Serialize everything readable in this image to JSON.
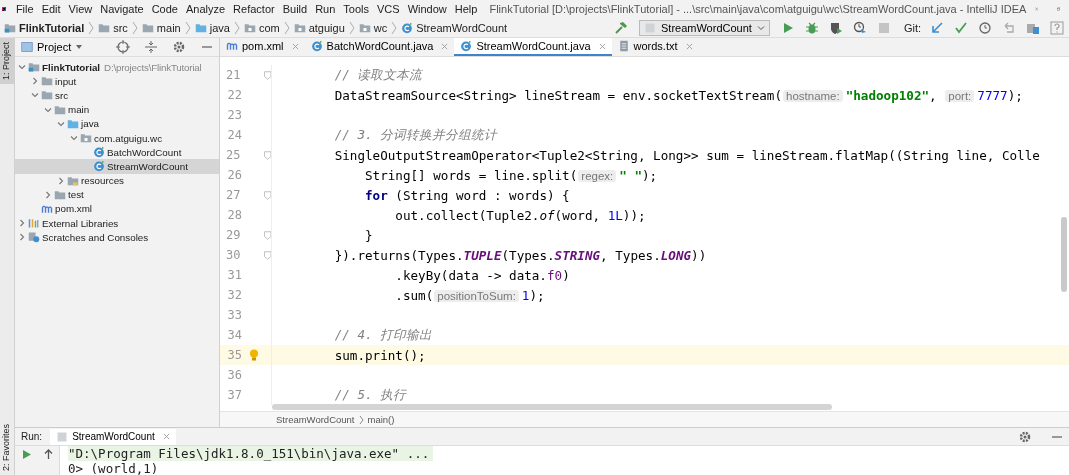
{
  "window": {
    "title": "FlinkTutorial [D:\\projects\\FlinkTutorial] - ...\\src\\main\\java\\com\\atguigu\\wc\\StreamWordCount.java - IntelliJ IDEA"
  },
  "menu": [
    "File",
    "Edit",
    "View",
    "Navigate",
    "Code",
    "Analyze",
    "Refactor",
    "Build",
    "Run",
    "Tools",
    "VCS",
    "Window",
    "Help"
  ],
  "nav_bar": {
    "crumbs": [
      {
        "label": "FlinkTutorial",
        "kind": "module"
      },
      {
        "label": "src",
        "kind": "folder"
      },
      {
        "label": "main",
        "kind": "folder"
      },
      {
        "label": "java",
        "kind": "source"
      },
      {
        "label": "com",
        "kind": "package"
      },
      {
        "label": "atguigu",
        "kind": "package"
      },
      {
        "label": "wc",
        "kind": "package"
      },
      {
        "label": "StreamWordCount",
        "kind": "class"
      }
    ],
    "run_config": "StreamWordCount",
    "vcs_label": "Git:"
  },
  "side_strip": {
    "top_tab": "1: Project",
    "bottom_tab": "2: Favorites"
  },
  "project": {
    "title": "Project",
    "tree": [
      {
        "label": "FlinkTutorial",
        "path": "D:\\projects\\FlinkTutorial",
        "kind": "module",
        "expanded": true,
        "selected": false,
        "children": [
          {
            "label": "input",
            "kind": "folder",
            "expanded": false,
            "selected": false
          },
          {
            "label": "src",
            "kind": "folder",
            "expanded": true,
            "selected": false,
            "children": [
              {
                "label": "main",
                "kind": "folder",
                "expanded": true,
                "selected": false,
                "children": [
                  {
                    "label": "java",
                    "kind": "source",
                    "expanded": true,
                    "selected": false,
                    "children": [
                      {
                        "label": "com.atguigu.wc",
                        "kind": "package",
                        "expanded": true,
                        "selected": false,
                        "children": [
                          {
                            "label": "BatchWordCount",
                            "kind": "class",
                            "selected": false
                          },
                          {
                            "label": "StreamWordCount",
                            "kind": "class",
                            "selected": true
                          }
                        ]
                      }
                    ]
                  },
                  {
                    "label": "resources",
                    "kind": "resources",
                    "expanded": false,
                    "selected": false
                  }
                ]
              },
              {
                "label": "test",
                "kind": "folder",
                "expanded": false,
                "selected": false
              }
            ]
          },
          {
            "label": "pom.xml",
            "kind": "maven",
            "selected": false
          }
        ]
      },
      {
        "label": "External Libraries",
        "kind": "libraries",
        "expanded": false,
        "selected": false
      },
      {
        "label": "Scratches and Consoles",
        "kind": "scratches",
        "expanded": false,
        "selected": false
      }
    ]
  },
  "tabs": [
    {
      "label": "pom.xml",
      "kind": "maven",
      "selected": false
    },
    {
      "label": "BatchWordCount.java",
      "kind": "class",
      "selected": false
    },
    {
      "label": "StreamWordCount.java",
      "kind": "class",
      "selected": true
    },
    {
      "label": "words.txt",
      "kind": "text",
      "selected": false
    }
  ],
  "editor": {
    "lines": [
      {
        "number": "21",
        "fold": true,
        "current": false,
        "tokens": [
          {
            "kind": "comment",
            "text": "        // 读取文本流"
          }
        ]
      },
      {
        "number": "22",
        "fold": false,
        "current": false,
        "tokens": [
          {
            "kind": "plain",
            "text": "        DataStreamSource<String> lineStream = env.socketTextStream("
          },
          {
            "kind": "hint",
            "text": "hostname:"
          },
          {
            "kind": "string",
            "text": "\"hadoop102\""
          },
          {
            "kind": "plain",
            "text": ", "
          },
          {
            "kind": "hint",
            "text": "port:"
          },
          {
            "kind": "number",
            "text": "7777"
          },
          {
            "kind": "plain",
            "text": ");"
          }
        ]
      },
      {
        "number": "23",
        "fold": false,
        "current": false
      },
      {
        "number": "24",
        "fold": false,
        "current": false,
        "tokens": [
          {
            "kind": "comment",
            "text": "        // 3. 分词转换并分组统计"
          }
        ]
      },
      {
        "number": "25",
        "fold": true,
        "current": false,
        "tokens": [
          {
            "kind": "plain",
            "text": "        SingleOutputStreamOperator<Tuple2<String, Long>> sum = lineStream.flatMap((String line, Colle"
          }
        ]
      },
      {
        "number": "26",
        "fold": false,
        "current": false,
        "tokens": [
          {
            "kind": "plain",
            "text": "            String[] words = line.split("
          },
          {
            "kind": "hint",
            "text": "regex:"
          },
          {
            "kind": "string",
            "text": "\" \""
          },
          {
            "kind": "plain",
            "text": ");"
          }
        ]
      },
      {
        "number": "27",
        "fold": true,
        "current": false,
        "tokens": [
          {
            "kind": "keyword",
            "text": "            for"
          },
          {
            "kind": "plain",
            "text": " (String word : words) {"
          }
        ]
      },
      {
        "number": "28",
        "fold": false,
        "current": false,
        "tokens": [
          {
            "kind": "plain",
            "text": "                out.collect(Tuple2."
          },
          {
            "kind": "italic",
            "text": "of"
          },
          {
            "kind": "plain",
            "text": "(word, "
          },
          {
            "kind": "number",
            "text": "1L"
          },
          {
            "kind": "plain",
            "text": "));"
          }
        ]
      },
      {
        "number": "29",
        "fold": true,
        "current": false,
        "tokens": [
          {
            "kind": "plain",
            "text": "            }"
          }
        ]
      },
      {
        "number": "30",
        "fold": true,
        "current": false,
        "tokens": [
          {
            "kind": "plain",
            "text": "        }).returns(Types."
          },
          {
            "kind": "const",
            "text": "TUPLE"
          },
          {
            "kind": "plain",
            "text": "(Types."
          },
          {
            "kind": "const",
            "text": "STRING"
          },
          {
            "kind": "plain",
            "text": ", Types."
          },
          {
            "kind": "const",
            "text": "LONG"
          },
          {
            "kind": "plain",
            "text": "))"
          }
        ]
      },
      {
        "number": "31",
        "fold": false,
        "current": false,
        "tokens": [
          {
            "kind": "plain",
            "text": "                .keyBy(data -> data."
          },
          {
            "kind": "field",
            "text": "f0"
          },
          {
            "kind": "plain",
            "text": ")"
          }
        ]
      },
      {
        "number": "32",
        "fold": false,
        "current": false,
        "tokens": [
          {
            "kind": "plain",
            "text": "                .sum("
          },
          {
            "kind": "hint",
            "text": "positionToSum:"
          },
          {
            "kind": "number",
            "text": "1"
          },
          {
            "kind": "plain",
            "text": ");"
          }
        ]
      },
      {
        "number": "33",
        "fold": false,
        "current": false
      },
      {
        "number": "34",
        "fold": false,
        "current": false,
        "tokens": [
          {
            "kind": "comment",
            "text": "        // 4. 打印输出"
          }
        ]
      },
      {
        "number": "35",
        "fold": false,
        "current": true,
        "tokens": [
          {
            "kind": "plain",
            "text": "        sum.print();"
          }
        ]
      },
      {
        "number": "36",
        "fold": false,
        "current": false
      },
      {
        "number": "37",
        "fold": false,
        "current": false,
        "tokens": [
          {
            "kind": "comment",
            "text": "        // 5. 执行"
          }
        ]
      }
    ],
    "breadcrumb": [
      "StreamWordCount",
      "main()"
    ]
  },
  "run_panel": {
    "label": "Run:",
    "tab": "StreamWordCount",
    "console": [
      {
        "text": "\"D:\\Program Files\\jdk1.8.0_151\\bin\\java.exe\" ...",
        "folded": true
      },
      {
        "text": "0> (world,1)",
        "folded": false
      }
    ]
  }
}
